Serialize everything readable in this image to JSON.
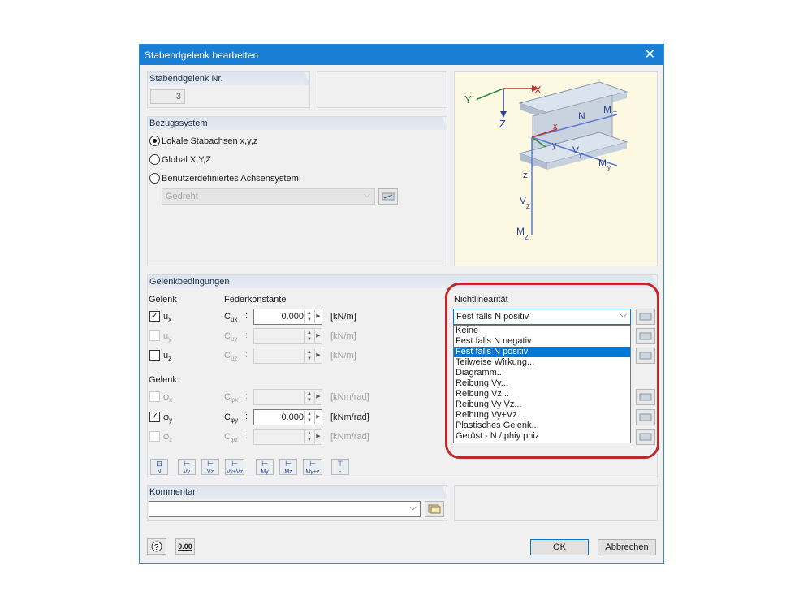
{
  "dialog": {
    "title": "Stabendgelenk bearbeiten",
    "close": "✕"
  },
  "nr_group": {
    "header": "Stabendgelenk Nr.",
    "value": "3"
  },
  "ref_group": {
    "header": "Bezugssystem",
    "options": [
      "Lokale Stabachsen x,y,z",
      "Global X,Y,Z",
      "Benutzerdefiniertes Achsensystem:"
    ],
    "selected": 0,
    "dropdown_value": "Gedreht"
  },
  "diagram": {
    "labels": {
      "X": "X",
      "Y": "Y",
      "Z": "Z",
      "x": "x",
      "y": "y",
      "z": "z",
      "N": "N",
      "MT": "M",
      "MT_sub": "T",
      "Vy": "V",
      "Vy_sub": "y",
      "My": "M",
      "My_sub": "y",
      "Vz": "V",
      "Vz_sub": "Z",
      "Mz": "M",
      "Mz_sub": "Z"
    }
  },
  "conditions": {
    "header": "Gelenkbedingungen",
    "col_gelenk": "Gelenk",
    "col_feder": "Federkonstante",
    "col_gelenk2": "Gelenk",
    "rows": [
      {
        "label": "u",
        "sub": "x",
        "checked": true,
        "enabled": true,
        "c": "C",
        "csub": "ux",
        "value": "0.000",
        "unit": "[kN/m]"
      },
      {
        "label": "u",
        "sub": "y",
        "checked": false,
        "enabled": false,
        "c": "C",
        "csub": "uy",
        "value": "",
        "unit": "[kN/m]"
      },
      {
        "label": "u",
        "sub": "z",
        "checked": false,
        "enabled": true,
        "c": "C",
        "csub": "uz",
        "value": "",
        "unit": "[kN/m]"
      },
      {
        "label": "φ",
        "sub": "x",
        "checked": false,
        "enabled": false,
        "c": "C",
        "csub": "φx",
        "value": "",
        "unit": "[kNm/rad]"
      },
      {
        "label": "φ",
        "sub": "y",
        "checked": true,
        "enabled": true,
        "c": "C",
        "csub": "φy",
        "value": "0.000",
        "unit": "[kNm/rad]"
      },
      {
        "label": "φ",
        "sub": "z",
        "checked": false,
        "enabled": false,
        "c": "C",
        "csub": "φz",
        "value": "",
        "unit": "[kNm/rad]"
      }
    ],
    "colon": ":"
  },
  "nonlinear": {
    "label": "Nichtlinearität",
    "selected": "Fest falls N positiv",
    "options": [
      "Keine",
      "Fest falls N negativ",
      "Fest falls N positiv",
      "Teilweise Wirkung...",
      "Diagramm...",
      "Reibung Vy...",
      "Reibung Vz...",
      "Reibung Vy Vz...",
      "Reibung Vy+Vz...",
      "Plastisches Gelenk...",
      "Gerüst - N / phiy phiz"
    ],
    "highlight_color": "#c0282d"
  },
  "toolbar": {
    "buttons": [
      "N",
      "Vy",
      "Vz",
      "Vy+Vz",
      "My",
      "Mz",
      "My+z",
      "-"
    ]
  },
  "comment": {
    "header": "Kommentar",
    "value": ""
  },
  "footer": {
    "ok": "OK",
    "cancel": "Abbrechen",
    "units_icon": "0.00"
  }
}
